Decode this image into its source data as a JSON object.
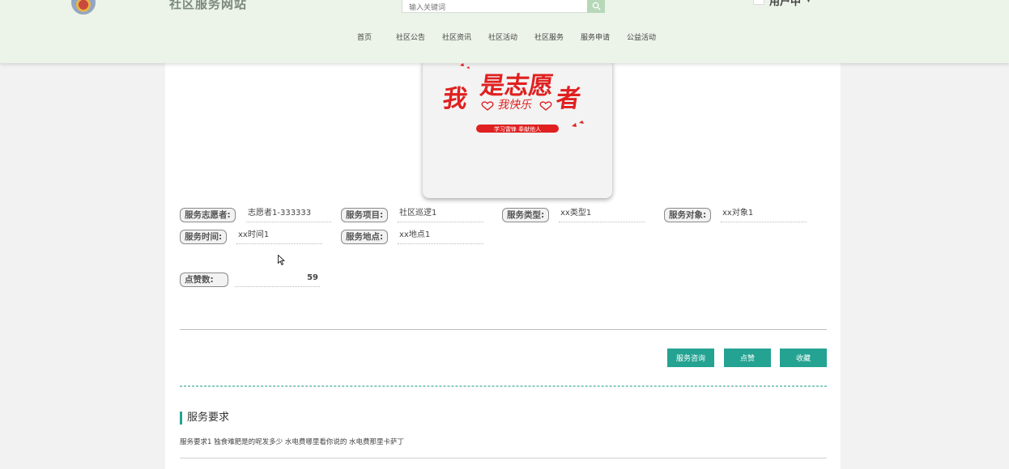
{
  "header": {
    "site_title": "社区服务网站",
    "search_placeholder": "输入关键词",
    "user_name": "用户中"
  },
  "nav": {
    "items": [
      "首页",
      "社区公告",
      "社区资讯",
      "社区活动",
      "社区服务",
      "服务申请",
      "公益活动"
    ]
  },
  "poster": {
    "headline_a": "我",
    "headline_b": "是志愿",
    "headline_c": "者",
    "subline": "我快乐",
    "banner": "学习雷锋 奉献他人",
    "colors": {
      "red": "#e02020",
      "bg": "#f3f3f3"
    }
  },
  "details": {
    "volunteer_label": "服务志愿者:",
    "volunteer_value": "志愿者1-333333",
    "project_label": "服务项目:",
    "project_value": "社区巡逻1",
    "type_label": "服务类型:",
    "type_value": "xx类型1",
    "target_label": "服务对象:",
    "target_value": "xx对象1",
    "time_label": "服务时间:",
    "time_value": "xx时间1",
    "place_label": "服务地点:",
    "place_value": "xx地点1",
    "likes_label": "点赞数:",
    "likes_value": "59"
  },
  "actions": {
    "consult": "服务咨询",
    "like": "点赞",
    "favorite": "收藏",
    "color": "#24a392"
  },
  "requirements": {
    "title": "服务要求",
    "text": "服务要求1 独食难肥是的呢发多少 水电费哪里看你说的 水电费那里卡萨丁"
  }
}
